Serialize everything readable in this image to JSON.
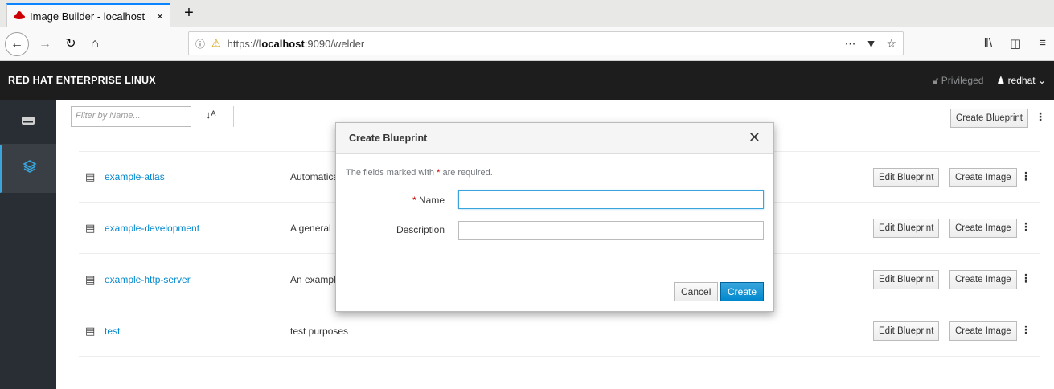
{
  "browser": {
    "tab_title": "Image Builder - localhost",
    "tab_close": "×",
    "new_tab": "+",
    "url_prefix": "https://",
    "url_host": "localhost",
    "url_path": ":9090/welder",
    "url_right_icons": [
      "more-icon",
      "pocket-icon",
      "bookmark-star-icon"
    ],
    "toolbar_icons": [
      "library-icon",
      "sidebar-icon",
      "menu-icon"
    ]
  },
  "masthead": {
    "brand": "RED HAT ENTERPRISE LINUX",
    "privileged": "Privileged",
    "user": "redhat"
  },
  "toolbar": {
    "filter_placeholder": "Filter by Name...",
    "create_blueprint": "Create Blueprint"
  },
  "blueprints": [
    {
      "name": "example-atlas",
      "description": "Automatica"
    },
    {
      "name": "example-development",
      "description": "A general"
    },
    {
      "name": "example-http-server",
      "description": "An exampl"
    },
    {
      "name": "test",
      "description": "test purposes"
    }
  ],
  "row_actions": {
    "edit": "Edit Blueprint",
    "create_image": "Create Image"
  },
  "modal": {
    "title": "Create Blueprint",
    "required_note_before": "The fields marked with ",
    "required_star": "*",
    "required_note_after": " are required.",
    "name_label": "Name",
    "description_label": "Description",
    "name_value": "",
    "description_value": "",
    "cancel": "Cancel",
    "create": "Create"
  },
  "colors": {
    "accent": "#0088ce",
    "masthead": "#1d1d1d",
    "sidebar": "#292e34",
    "primary_button": "#0088ce"
  }
}
